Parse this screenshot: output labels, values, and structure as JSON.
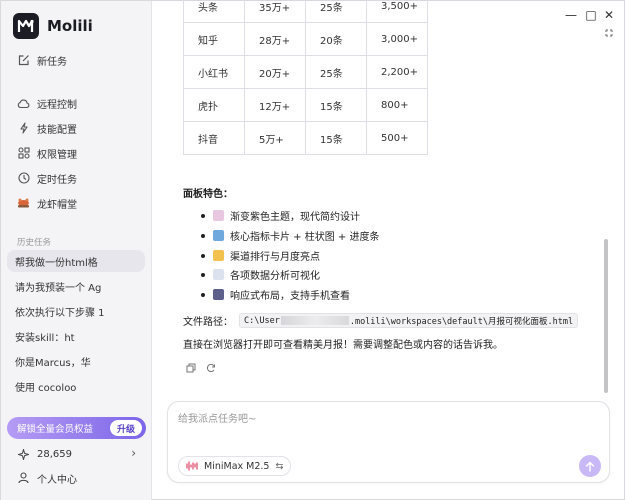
{
  "app": {
    "name": "Molili"
  },
  "sidebar": {
    "new_task": "新任务",
    "items": [
      "远程控制",
      "技能配置",
      "权限管理",
      "定时任务",
      "龙虾帽堂"
    ],
    "history_label": "历史任务",
    "history": [
      "帮我做一份html格",
      "请为我预装一个 Ag",
      "依次执行以下步骤 1",
      "安装skill：ht",
      "你是Marcus，华",
      "使用 cocoloo"
    ],
    "vip_label": "解锁全量会员权益",
    "vip_button": "升级",
    "points": "28,659",
    "user_center": "个人中心"
  },
  "table": {
    "rows": [
      [
        "头条",
        "35万+",
        "25条",
        "3,500+"
      ],
      [
        "知乎",
        "28万+",
        "20条",
        "3,000+"
      ],
      [
        "小红书",
        "20万+",
        "25条",
        "2,200+"
      ],
      [
        "虎扑",
        "12万+",
        "15条",
        "800+"
      ],
      [
        "抖音",
        "5万+",
        "15条",
        "500+"
      ]
    ]
  },
  "features": {
    "title": "面板特色：",
    "items": [
      "渐变紫色主题，现代简约设计",
      "核心指标卡片 + 柱状图 + 进度条",
      "渠道排行与月度亮点",
      "各项数据分析可视化",
      "响应式布局，支持手机查看"
    ]
  },
  "file": {
    "label": "文件路径：",
    "path_start": "C:\\User",
    "path_end": ".molili\\workspaces\\default\\月报可视化面板.html"
  },
  "reply_text": "直接在浏览器打开即可查看精美月报！需要调整配色或内容的话告诉我。",
  "input": {
    "placeholder": "给我派点任务吧~",
    "model": "MiniMax M2.5",
    "swap_symbol": "⇆"
  },
  "window": {
    "minimize": "—",
    "maximize": "□",
    "close": "✕"
  },
  "colors": {
    "accent": "#7c65e8",
    "send": "#c9b8f6"
  }
}
